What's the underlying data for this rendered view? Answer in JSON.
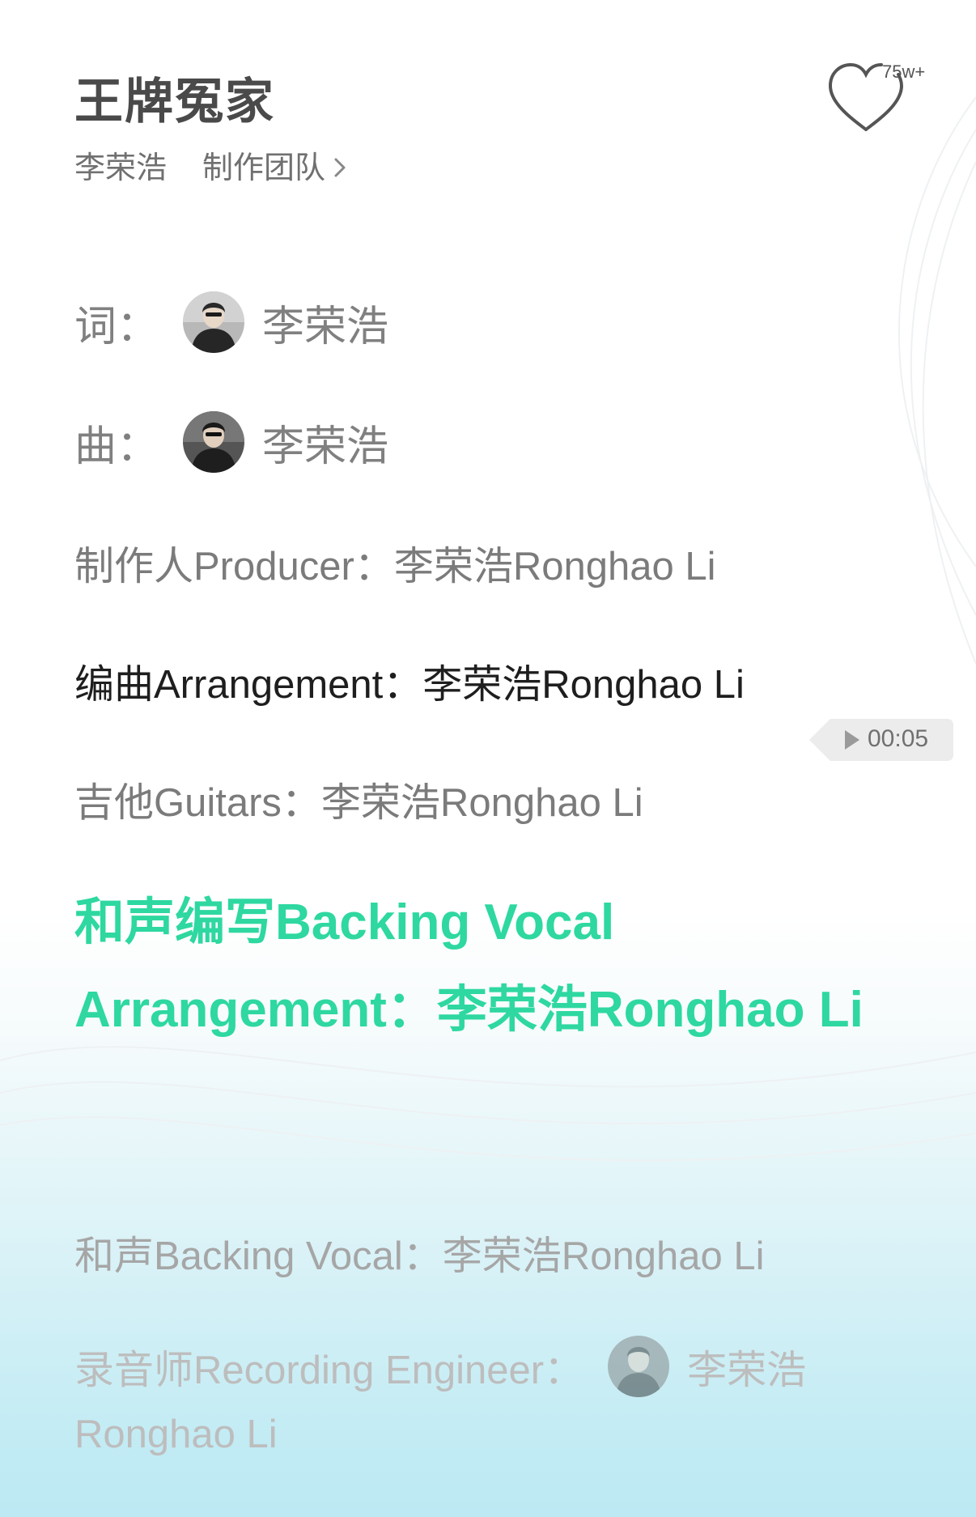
{
  "song": {
    "title": "王牌冤家",
    "artist": "李荣浩",
    "team_link": "制作团队",
    "like_count": "75w+"
  },
  "credits": {
    "lyrics_label": "词：",
    "lyrics_name": "李荣浩",
    "music_label": "曲：",
    "music_name": "李荣浩",
    "producer": "制作人Producer：李荣浩Ronghao Li",
    "arrangement": "编曲Arrangement：李荣浩Ronghao Li",
    "guitars": "吉他Guitars：李荣浩Ronghao Li",
    "backing_vocal_arrangement": "和声编写Backing Vocal Arrangement：李荣浩Ronghao Li",
    "backing_vocal": "和声Backing Vocal：李荣浩Ronghao Li",
    "recording_engineer_label": "录音师Recording Engineer：",
    "recording_engineer_name": "李荣浩",
    "recording_engineer_name_en": "Ronghao Li"
  },
  "playback": {
    "timestamp": "00:05"
  },
  "icons": {
    "like": "heart-outline-icon",
    "chevron": "chevron-right-icon",
    "play": "play-icon"
  },
  "colors": {
    "highlight": "#2ed8a0",
    "title": "#4a4a4a"
  }
}
